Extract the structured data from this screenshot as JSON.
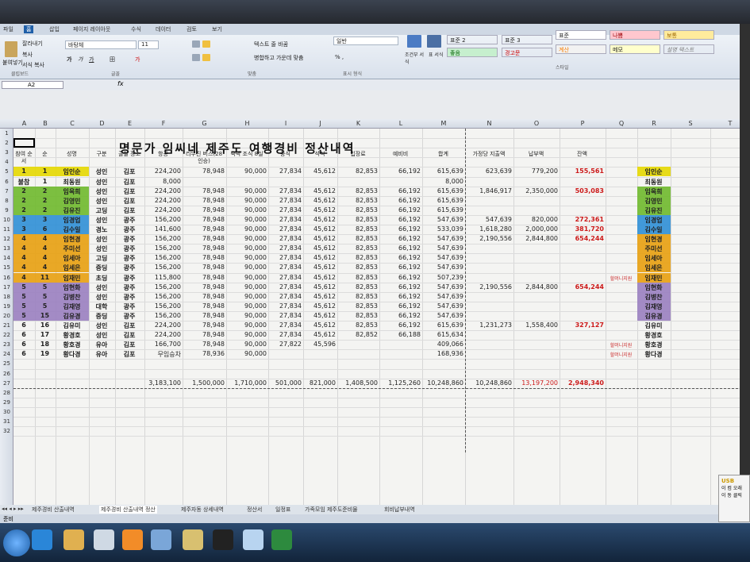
{
  "ribbon": {
    "tabs": [
      "파일",
      "홈",
      "삽입",
      "페이지 레이아웃",
      "수식",
      "데이터",
      "검토",
      "보기"
    ],
    "clipboard": {
      "cut": "잘라내기",
      "copy": "복사",
      "format_painter": "서식 복사",
      "paste": "붙여넣기",
      "group": "클립보드"
    },
    "font": {
      "name": "바탕체",
      "size": "11",
      "group": "글꼴"
    },
    "alignment": {
      "wrap": "텍스트 줄 바꿈",
      "merge": "병합하고 가운데 맞춤",
      "group": "맞춤"
    },
    "number": {
      "format": "일반",
      "group": "표시 형식"
    },
    "styles": {
      "conditional": "조건부 서식",
      "table": "표 서식",
      "group": "스타일",
      "cells": [
        {
          "label": "표준 2",
          "bg": "#ffffff"
        },
        {
          "label": "표준 3",
          "bg": "#ffffff"
        },
        {
          "label": "표준",
          "bg": "#ffffff"
        },
        {
          "label": "나쁨",
          "bg": "#ffc7ce"
        },
        {
          "label": "보통",
          "bg": "#ffeb9c"
        },
        {
          "label": "좋음",
          "bg": "#c6efce"
        },
        {
          "label": "경고문",
          "bg": "#ffffff"
        },
        {
          "label": "계산",
          "bg": "#f2f2f2"
        },
        {
          "label": "메모",
          "bg": "#ffffcc"
        },
        {
          "label": "설명 텍스트",
          "bg": "#ffffff"
        }
      ]
    }
  },
  "formula_bar": {
    "cell_ref": "A2",
    "fx": "fx"
  },
  "columns": [
    "A",
    "B",
    "C",
    "D",
    "E",
    "F",
    "G",
    "H",
    "I",
    "J",
    "K",
    "L",
    "M",
    "N",
    "O",
    "P",
    "Q",
    "R",
    "S",
    "T"
  ],
  "rows": [
    "1",
    "2",
    "3",
    "4",
    "5",
    "6",
    "7",
    "8",
    "9",
    "10",
    "11",
    "12",
    "13",
    "14",
    "15",
    "16",
    "17",
    "18",
    "19",
    "20",
    "21",
    "22",
    "23",
    "24",
    "25",
    "26",
    "27",
    "28",
    "29",
    "30",
    "31",
    "32"
  ],
  "title": "명문가 임씨네 제주도 여행경비 정산내역",
  "headers": {
    "A": "참여 순서",
    "B": "순",
    "C": "성명",
    "D": "구분",
    "E": "출발 장소",
    "F": "항공",
    "G": "리무진 버스(28인승)",
    "H": "숙박 조식 8실",
    "I": "중식",
    "J": "석식",
    "K": "입장료",
    "L": "예비비",
    "M": "합계",
    "N": "가정당 지출액",
    "O": "납부액",
    "P": "잔액"
  },
  "table_rows": [
    {
      "a": "1",
      "b": "1",
      "name": "임인순",
      "d": "성인",
      "e": "김포",
      "f": "224,200",
      "g": "78,948",
      "h": "90,000",
      "i": "27,834",
      "j": "45,612",
      "k": "82,853",
      "l": "66,192",
      "m": "615,639",
      "n": "623,639",
      "o": "779,200",
      "p": "155,561",
      "r": "임인순",
      "color": "#e6d800"
    },
    {
      "a": "불참",
      "b": "1",
      "name": "최동원",
      "d": "성인",
      "e": "김포",
      "f": "8,000",
      "g": "",
      "h": "",
      "i": "",
      "j": "",
      "k": "",
      "l": "",
      "m": "8,000",
      "n": "",
      "o": "",
      "p": "",
      "r": "최동원",
      "color": ""
    },
    {
      "a": "2",
      "b": "2",
      "name": "임옥희",
      "d": "성인",
      "e": "김포",
      "f": "224,200",
      "g": "78,948",
      "h": "90,000",
      "i": "27,834",
      "j": "45,612",
      "k": "82,853",
      "l": "66,192",
      "m": "615,639",
      "n": "1,846,917",
      "o": "2,350,000",
      "p": "503,083",
      "r": "임옥희",
      "color": "#6fb92c"
    },
    {
      "a": "2",
      "b": "2",
      "name": "김영민",
      "d": "성인",
      "e": "김포",
      "f": "224,200",
      "g": "78,948",
      "h": "90,000",
      "i": "27,834",
      "j": "45,612",
      "k": "82,853",
      "l": "66,192",
      "m": "615,639",
      "n": "",
      "o": "",
      "p": "",
      "r": "김영민",
      "color": "#6fb92c"
    },
    {
      "a": "2",
      "b": "2",
      "name": "김유진",
      "d": "고딩",
      "e": "김포",
      "f": "224,200",
      "g": "78,948",
      "h": "90,000",
      "i": "27,834",
      "j": "45,612",
      "k": "82,853",
      "l": "66,192",
      "m": "615,639",
      "n": "",
      "o": "",
      "p": "",
      "r": "김유진",
      "color": "#6fb92c"
    },
    {
      "a": "3",
      "b": "3",
      "name": "임경업",
      "d": "성인",
      "e": "광주",
      "f": "156,200",
      "g": "78,948",
      "h": "90,000",
      "i": "27,834",
      "j": "45,612",
      "k": "82,853",
      "l": "66,192",
      "m": "547,639",
      "n": "547,639",
      "o": "820,000",
      "p": "272,361",
      "r": "임경업",
      "color": "#2f8fd6"
    },
    {
      "a": "3",
      "b": "6",
      "name": "김수일",
      "d": "경노",
      "e": "광주",
      "f": "141,600",
      "g": "78,948",
      "h": "90,000",
      "i": "27,834",
      "j": "45,612",
      "k": "82,853",
      "l": "66,192",
      "m": "533,039",
      "n": "1,618,280",
      "o": "2,000,000",
      "p": "381,720",
      "r": "김수일",
      "color": "#2f8fd6"
    },
    {
      "a": "4",
      "b": "4",
      "name": "임현경",
      "d": "성인",
      "e": "광주",
      "f": "156,200",
      "g": "78,948",
      "h": "90,000",
      "i": "27,834",
      "j": "45,612",
      "k": "82,853",
      "l": "66,192",
      "m": "547,639",
      "n": "2,190,556",
      "o": "2,844,800",
      "p": "654,244",
      "r": "임현경",
      "color": "#e8a010"
    },
    {
      "a": "4",
      "b": "4",
      "name": "주미선",
      "d": "성인",
      "e": "광주",
      "f": "156,200",
      "g": "78,948",
      "h": "90,000",
      "i": "27,834",
      "j": "45,612",
      "k": "82,853",
      "l": "66,192",
      "m": "547,639",
      "n": "",
      "o": "",
      "p": "",
      "r": "주미선",
      "color": "#e8a010"
    },
    {
      "a": "4",
      "b": "4",
      "name": "임세아",
      "d": "고딩",
      "e": "광주",
      "f": "156,200",
      "g": "78,948",
      "h": "90,000",
      "i": "27,834",
      "j": "45,612",
      "k": "82,853",
      "l": "66,192",
      "m": "547,639",
      "n": "",
      "o": "",
      "p": "",
      "r": "임세아",
      "color": "#e8a010"
    },
    {
      "a": "4",
      "b": "4",
      "name": "임세은",
      "d": "중딩",
      "e": "광주",
      "f": "156,200",
      "g": "78,948",
      "h": "90,000",
      "i": "27,834",
      "j": "45,612",
      "k": "82,853",
      "l": "66,192",
      "m": "547,639",
      "n": "",
      "o": "",
      "p": "",
      "r": "임세은",
      "color": "#e8a010"
    },
    {
      "a": "4",
      "b": "11",
      "name": "임재민",
      "d": "초딩",
      "e": "광주",
      "f": "115,800",
      "g": "78,948",
      "h": "90,000",
      "i": "27,834",
      "j": "45,612",
      "k": "82,853",
      "l": "66,192",
      "m": "507,239",
      "n": "",
      "o": "",
      "p": "",
      "q": "할머니지원",
      "r": "임재민",
      "color": "#e8a010"
    },
    {
      "a": "5",
      "b": "5",
      "name": "임현화",
      "d": "성인",
      "e": "광주",
      "f": "156,200",
      "g": "78,948",
      "h": "90,000",
      "i": "27,834",
      "j": "45,612",
      "k": "82,853",
      "l": "66,192",
      "m": "547,639",
      "n": "2,190,556",
      "o": "2,844,800",
      "p": "654,244",
      "r": "임현화",
      "color": "#9a7fc0"
    },
    {
      "a": "5",
      "b": "5",
      "name": "김병찬",
      "d": "성인",
      "e": "광주",
      "f": "156,200",
      "g": "78,948",
      "h": "90,000",
      "i": "27,834",
      "j": "45,612",
      "k": "82,853",
      "l": "66,192",
      "m": "547,639",
      "n": "",
      "o": "",
      "p": "",
      "r": "김병찬",
      "color": "#9a7fc0"
    },
    {
      "a": "5",
      "b": "5",
      "name": "김재영",
      "d": "대학",
      "e": "광주",
      "f": "156,200",
      "g": "78,948",
      "h": "90,000",
      "i": "27,834",
      "j": "45,612",
      "k": "82,853",
      "l": "66,192",
      "m": "547,639",
      "n": "",
      "o": "",
      "p": "",
      "r": "김재영",
      "color": "#9a7fc0"
    },
    {
      "a": "5",
      "b": "15",
      "name": "김유경",
      "d": "중딩",
      "e": "광주",
      "f": "156,200",
      "g": "78,948",
      "h": "90,000",
      "i": "27,834",
      "j": "45,612",
      "k": "82,853",
      "l": "66,192",
      "m": "547,639",
      "n": "",
      "o": "",
      "p": "",
      "r": "김유경",
      "color": "#9a7fc0"
    },
    {
      "a": "6",
      "b": "16",
      "name": "김유미",
      "d": "성인",
      "e": "김포",
      "f": "224,200",
      "g": "78,948",
      "h": "90,000",
      "i": "27,834",
      "j": "45,612",
      "k": "82,853",
      "l": "66,192",
      "m": "615,639",
      "n": "1,231,273",
      "o": "1,558,400",
      "p": "327,127",
      "r": "김유미",
      "color": ""
    },
    {
      "a": "6",
      "b": "17",
      "name": "황경호",
      "d": "성인",
      "e": "김포",
      "f": "224,200",
      "g": "78,948",
      "h": "90,000",
      "i": "27,834",
      "j": "45,612",
      "k": "82,852",
      "l": "66,188",
      "m": "615,634",
      "n": "",
      "o": "",
      "p": "",
      "r": "황경호",
      "color": ""
    },
    {
      "a": "6",
      "b": "18",
      "name": "황호경",
      "d": "유아",
      "e": "김포",
      "f": "166,700",
      "g": "78,948",
      "h": "90,000",
      "i": "27,822",
      "j": "45,596",
      "k": "",
      "l": "",
      "m": "409,066",
      "n": "",
      "o": "",
      "p": "",
      "q": "할머니지원",
      "r": "황호경",
      "color": ""
    },
    {
      "a": "6",
      "b": "19",
      "name": "황다경",
      "d": "유아",
      "e": "김포",
      "f": "무임승차",
      "g": "78,936",
      "h": "90,000",
      "i": "",
      "j": "",
      "k": "",
      "l": "",
      "m": "168,936",
      "n": "",
      "o": "",
      "p": "",
      "q": "할머니지원",
      "r": "황다경",
      "color": ""
    }
  ],
  "totals": {
    "f": "3,183,100",
    "g": "1,500,000",
    "h": "1,710,000",
    "i": "501,000",
    "j": "821,000",
    "k": "1,408,500",
    "l": "1,125,260",
    "m": "10,248,860",
    "n": "10,248,860",
    "o": "13,197,200",
    "p": "2,948,340"
  },
  "sheet_tabs": [
    "제주경비 산출내역",
    "제주경비 산출내역 정산",
    "제주자동 상세내역",
    "정산서",
    "일정표",
    "가족모임 제주도준비물",
    "회비납부내역"
  ],
  "status": "준비",
  "notification": {
    "title": "USB",
    "body": "이 컴 오래 이 동 클릭"
  }
}
